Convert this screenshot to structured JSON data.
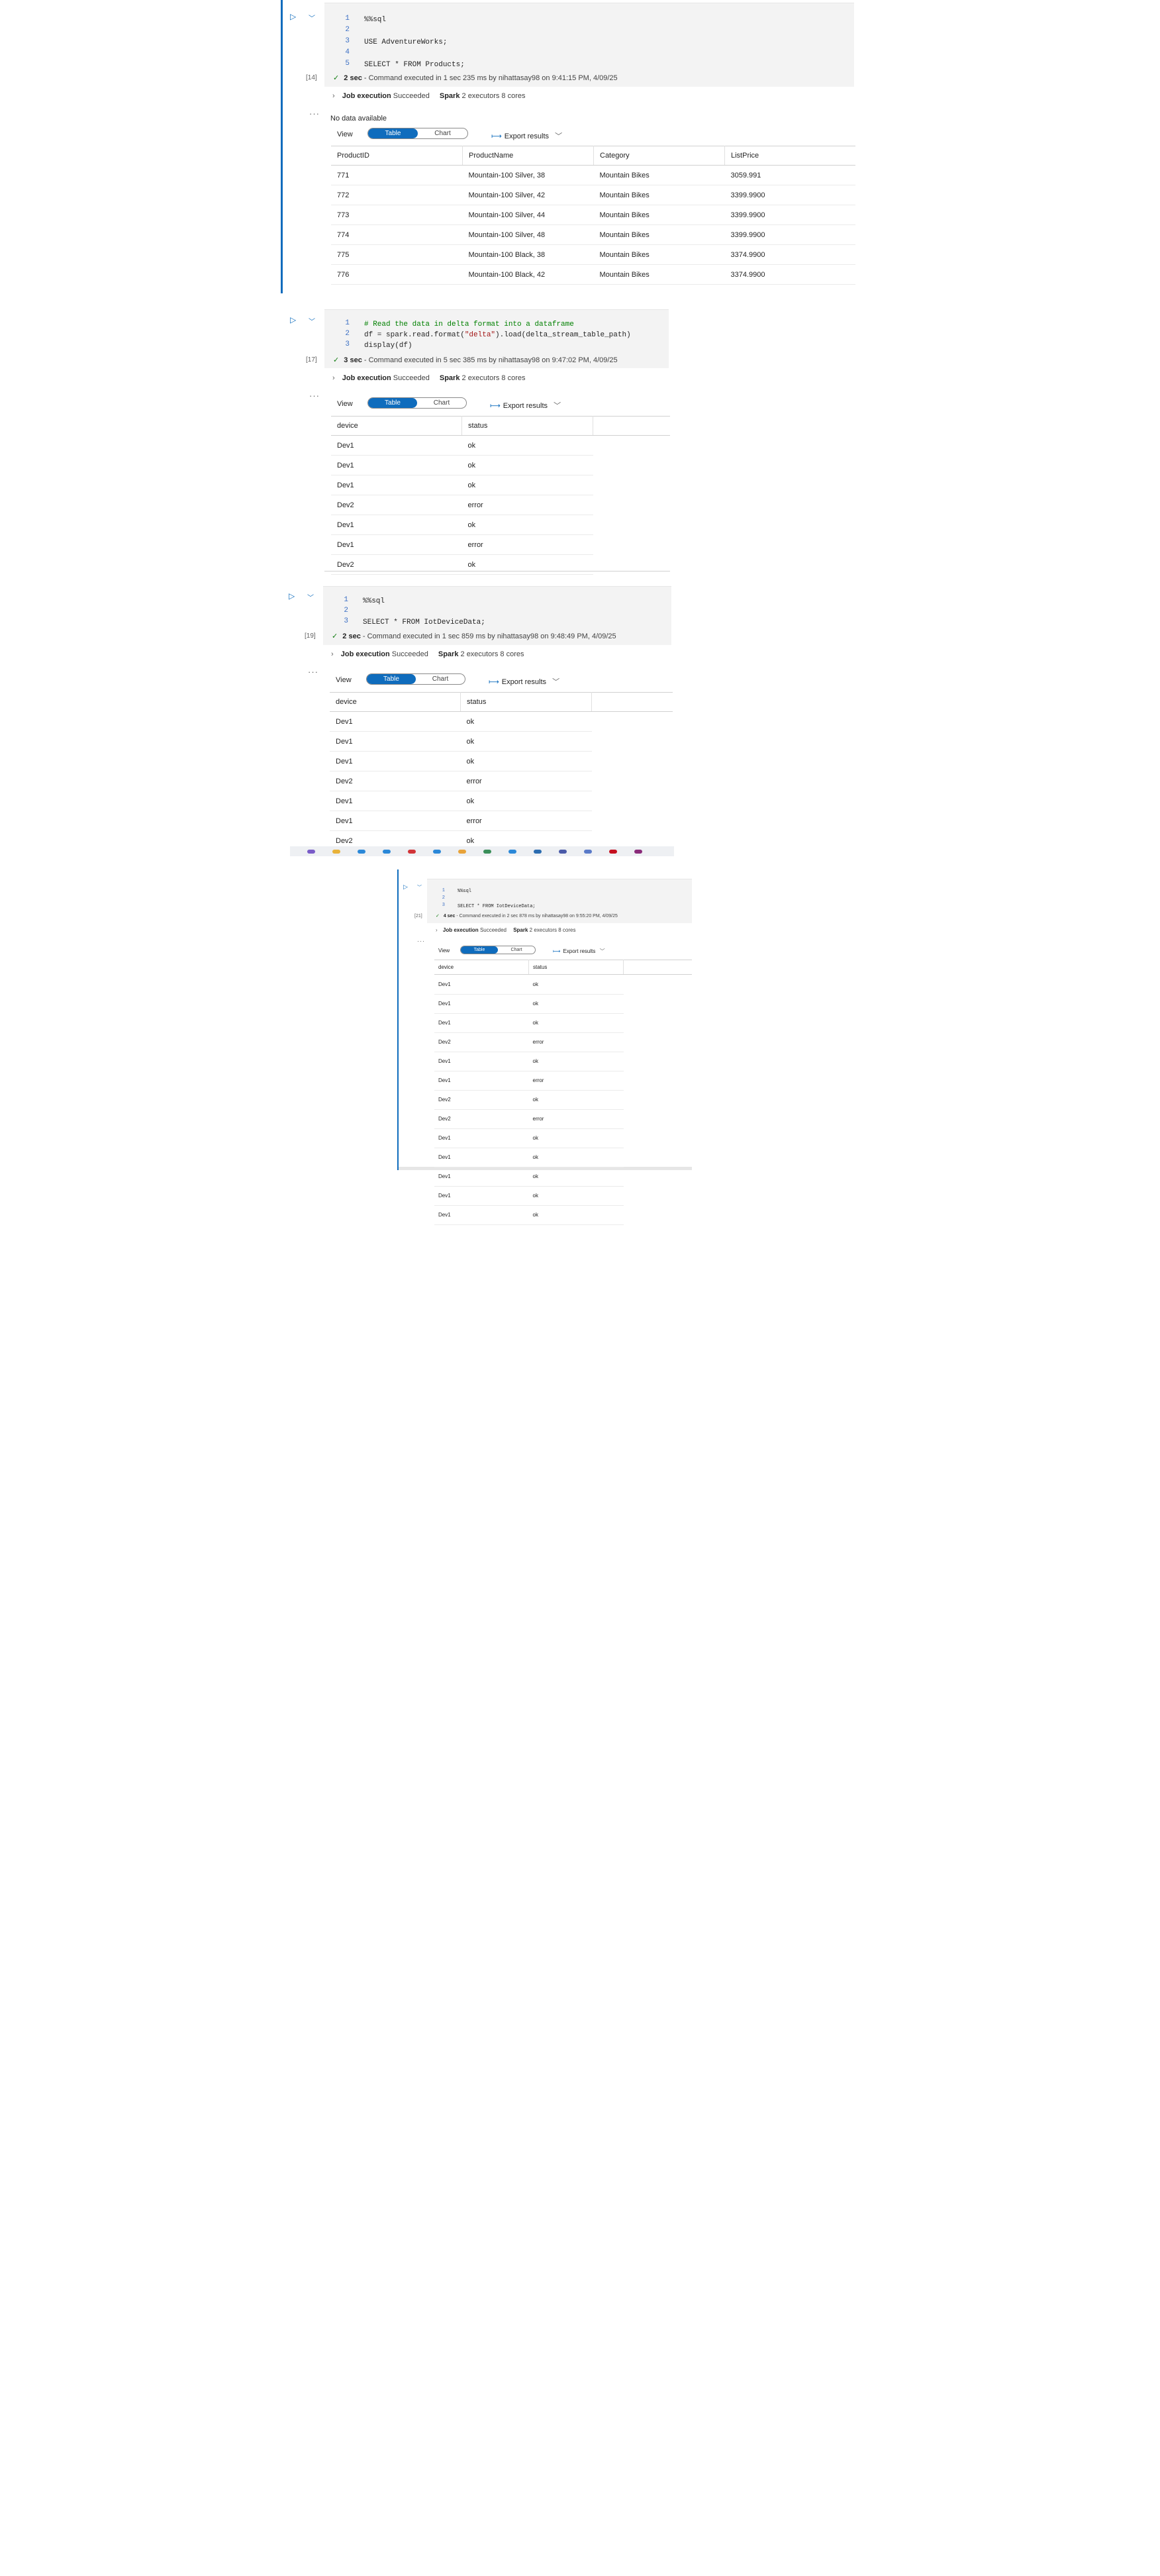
{
  "cell1": {
    "exec": "[14]",
    "lines": [
      "%%sql",
      "",
      "USE AdventureWorks;",
      "",
      "SELECT * FROM Products;"
    ],
    "line_numbers": [
      "1",
      "2",
      "3",
      "4",
      "5"
    ],
    "duration": "2 sec",
    "status": "- Command executed in 1 sec 235 ms by nihattasay98 on 9:41:15 PM, 4/09/25",
    "job_label": "Job execution",
    "job_state": "Succeeded",
    "spark_label": "Spark",
    "spark_info": "2 executors 8 cores",
    "no_data": "No data available",
    "view_label": "View",
    "toggle_table": "Table",
    "toggle_chart": "Chart",
    "export": "Export results",
    "columns": [
      "ProductID",
      "ProductName",
      "Category",
      "ListPrice"
    ],
    "rows": [
      [
        "771",
        "Mountain-100 Silver, 38",
        "Mountain Bikes",
        "3059.991"
      ],
      [
        "772",
        "Mountain-100 Silver, 42",
        "Mountain Bikes",
        "3399.9900"
      ],
      [
        "773",
        "Mountain-100 Silver, 44",
        "Mountain Bikes",
        "3399.9900"
      ],
      [
        "774",
        "Mountain-100 Silver, 48",
        "Mountain Bikes",
        "3399.9900"
      ],
      [
        "775",
        "Mountain-100 Black, 38",
        "Mountain Bikes",
        "3374.9900"
      ],
      [
        "776",
        "Mountain-100 Black, 42",
        "Mountain Bikes",
        "3374.9900"
      ]
    ]
  },
  "cell2": {
    "exec": "[17]",
    "line_numbers": [
      "1",
      "2",
      "3"
    ],
    "comment": "# Read the data in delta format into a dataframe",
    "code2_pre": "df = spark.read.format(",
    "code2_str": "\"delta\"",
    "code2_post": ").load(delta_stream_table_path)",
    "code3": "display(df)",
    "duration": "3 sec",
    "status": "- Command executed in 5 sec 385 ms by nihattasay98 on 9:47:02 PM, 4/09/25",
    "job_label": "Job execution",
    "job_state": "Succeeded",
    "spark_label": "Spark",
    "spark_info": "2 executors 8 cores",
    "view_label": "View",
    "toggle_table": "Table",
    "toggle_chart": "Chart",
    "export": "Export results",
    "columns": [
      "device",
      "status"
    ],
    "rows": [
      [
        "Dev1",
        "ok"
      ],
      [
        "Dev1",
        "ok"
      ],
      [
        "Dev1",
        "ok"
      ],
      [
        "Dev2",
        "error"
      ],
      [
        "Dev1",
        "ok"
      ],
      [
        "Dev1",
        "error"
      ],
      [
        "Dev2",
        "ok"
      ]
    ]
  },
  "cell3": {
    "exec": "[19]",
    "line_numbers": [
      "1",
      "2",
      "3"
    ],
    "lines": [
      "%%sql",
      "",
      "SELECT * FROM IotDeviceData;"
    ],
    "duration": "2 sec",
    "status": "- Command executed in 1 sec 859 ms by nihattasay98 on 9:48:49 PM, 4/09/25",
    "job_label": "Job execution",
    "job_state": "Succeeded",
    "spark_label": "Spark",
    "spark_info": "2 executors 8 cores",
    "view_label": "View",
    "toggle_table": "Table",
    "toggle_chart": "Chart",
    "export": "Export results",
    "columns": [
      "device",
      "status"
    ],
    "rows": [
      [
        "Dev1",
        "ok"
      ],
      [
        "Dev1",
        "ok"
      ],
      [
        "Dev1",
        "ok"
      ],
      [
        "Dev2",
        "error"
      ],
      [
        "Dev1",
        "ok"
      ],
      [
        "Dev1",
        "error"
      ],
      [
        "Dev2",
        "ok"
      ]
    ]
  },
  "cell4": {
    "exec": "[21]",
    "line_numbers": [
      "1",
      "2",
      "3"
    ],
    "lines": [
      "%%sql",
      "",
      "SELECT * FROM IotDeviceData;"
    ],
    "duration": "4 sec",
    "status": "- Command executed in 2 sec 878 ms by nihattasay98 on 9:55:20 PM, 4/09/25",
    "job_label": "Job execution",
    "job_state": "Succeeded",
    "spark_label": "Spark",
    "spark_info": "2 executors 8 cores",
    "view_label": "View",
    "toggle_table": "Table",
    "toggle_chart": "Chart",
    "export": "Export results",
    "columns": [
      "device",
      "status"
    ],
    "rows": [
      [
        "Dev1",
        "ok"
      ],
      [
        "Dev1",
        "ok"
      ],
      [
        "Dev1",
        "ok"
      ],
      [
        "Dev2",
        "error"
      ],
      [
        "Dev1",
        "ok"
      ],
      [
        "Dev1",
        "error"
      ],
      [
        "Dev2",
        "ok"
      ],
      [
        "Dev2",
        "error"
      ],
      [
        "Dev1",
        "ok"
      ],
      [
        "Dev1",
        "ok"
      ],
      [
        "Dev1",
        "ok"
      ],
      [
        "Dev1",
        "ok"
      ],
      [
        "Dev1",
        "ok"
      ]
    ]
  },
  "icons": {
    "run": "play-icon",
    "collapse": "chevron-down-icon",
    "check": "checkmark-icon",
    "expand": "chevron-right-icon",
    "more": "more-options-icon",
    "export": "export-arrow-icon"
  },
  "colors": {
    "accent": "#0f6cbd",
    "success": "#107c10",
    "code_bg": "#f3f3f3"
  }
}
